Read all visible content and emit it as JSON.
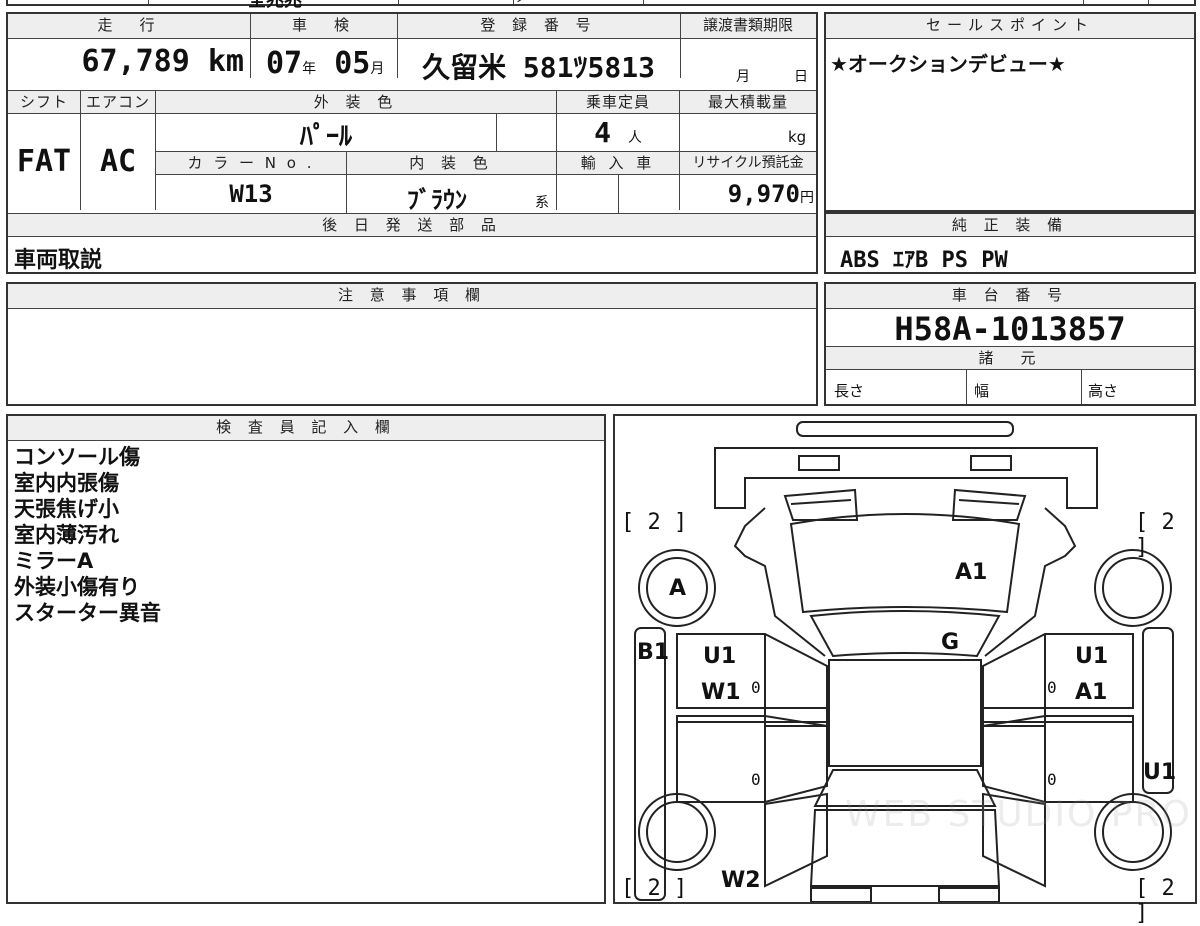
{
  "top_strip": {
    "partial_text": "全兆兆",
    "partial_mark": "ッ"
  },
  "main": {
    "headers": {
      "mileage": "走　行",
      "inspection": "車　検",
      "registration": "登 録 番 号",
      "transfer_deadline": "譲渡書類期限",
      "shift": "シフト",
      "aircon": "エアコン",
      "exterior_color": "外 装 色",
      "capacity": "乗車定員",
      "max_load": "最大積載量",
      "color_no": "カ ラ ー N o .",
      "interior_color": "内 装 色",
      "import": "輸 入 車",
      "recycle": "リサイクル預託金"
    },
    "mileage_value": "67,789",
    "mileage_unit": "km",
    "inspection_year": "07",
    "inspection_year_unit": "年",
    "inspection_month": "05",
    "inspection_month_unit": "月",
    "registration_value": "久留米 581ﾂ5813",
    "transfer_month_unit": "月",
    "transfer_day_unit": "日",
    "shift_value": "FAT",
    "aircon_value": "AC",
    "exterior_color_value": "ﾊﾟｰﾙ",
    "capacity_value": "4",
    "capacity_unit": "人",
    "max_load_unit": "kg",
    "color_no_value": "W13",
    "interior_color_value": "ﾌﾞﾗｳﾝ",
    "interior_color_suffix": "系",
    "recycle_value": "9,970",
    "recycle_unit": "円"
  },
  "later_parts": {
    "header": "後 日 発 送 部 品",
    "value": "車両取説"
  },
  "sales_point": {
    "header": "セールスポイント",
    "value": "★オークションデビュー★"
  },
  "genuine_equipment": {
    "header": "純 正 装 備",
    "value": "ABS ｴｱB PS PW"
  },
  "caution": {
    "header": "注 意 事 項 欄"
  },
  "chassis": {
    "header": "車 台 番 号",
    "value": "H58A-1013857",
    "specs_header": "諸　元",
    "length": "長さ",
    "width": "幅",
    "height": "高さ"
  },
  "inspector": {
    "header": "検 査 員 記 入 欄",
    "notes": [
      "コンソール傷",
      "室内内張傷",
      "天張焦げ小",
      "室内薄汚れ",
      "ミラーA",
      "外装小傷有り",
      "スターター異音"
    ]
  },
  "diagram": {
    "bracket_tl": "[ 2 ]",
    "bracket_tr": "[ 2 ]",
    "bracket_bl": "[ 2 ]",
    "bracket_br": "[ 2 ]",
    "label_a": "A",
    "label_a1_hood": "A1",
    "label_g": "G",
    "label_b1": "B1",
    "label_u1_left": "U1",
    "label_w1_left": "W1",
    "label_u1_right": "U1",
    "label_a1_right": "A1",
    "label_u1_side": "U1",
    "label_w2": "W2",
    "zero1": "0",
    "zero2": "0",
    "zero3": "0",
    "zero4": "0",
    "watermark": "WEB STUDIO PRO"
  }
}
